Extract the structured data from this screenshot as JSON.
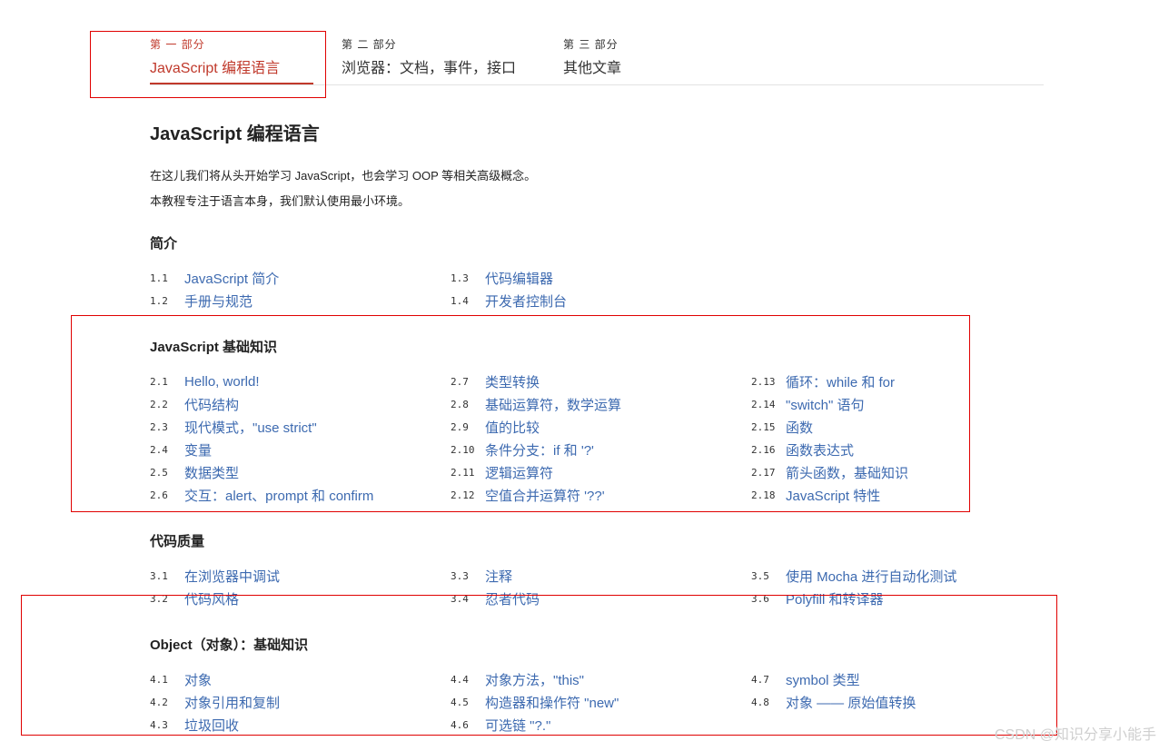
{
  "tabs": [
    {
      "kicker": "第 一 部分",
      "label": "JavaScript 编程语言",
      "active": true
    },
    {
      "kicker": "第 二 部分",
      "label": "浏览器：文档，事件，接口",
      "active": false
    },
    {
      "kicker": "第 三 部分",
      "label": "其他文章",
      "active": false
    }
  ],
  "main": {
    "title": "JavaScript 编程语言",
    "intro": [
      "在这儿我们将从头开始学习 JavaScript，也会学习 OOP 等相关高级概念。",
      "本教程专注于语言本身，我们默认使用最小环境。"
    ]
  },
  "sections": [
    {
      "title": "简介",
      "items": [
        {
          "num": "1.1",
          "text": "JavaScript 简介"
        },
        {
          "num": "1.2",
          "text": "手册与规范"
        },
        {
          "num": "1.3",
          "text": "代码编辑器"
        },
        {
          "num": "1.4",
          "text": "开发者控制台"
        }
      ]
    },
    {
      "title": "JavaScript 基础知识",
      "items": [
        {
          "num": "2.1",
          "text": "Hello, world!"
        },
        {
          "num": "2.2",
          "text": "代码结构"
        },
        {
          "num": "2.3",
          "text": "现代模式，\"use strict\""
        },
        {
          "num": "2.4",
          "text": "变量"
        },
        {
          "num": "2.5",
          "text": "数据类型"
        },
        {
          "num": "2.6",
          "text": "交互：alert、prompt 和 confirm"
        },
        {
          "num": "2.7",
          "text": "类型转换"
        },
        {
          "num": "2.8",
          "text": "基础运算符，数学运算"
        },
        {
          "num": "2.9",
          "text": "值的比较"
        },
        {
          "num": "2.10",
          "text": "条件分支：if 和 '?'"
        },
        {
          "num": "2.11",
          "text": "逻辑运算符"
        },
        {
          "num": "2.12",
          "text": "空值合并运算符 '??'"
        },
        {
          "num": "2.13",
          "text": "循环：while 和 for"
        },
        {
          "num": "2.14",
          "text": "\"switch\" 语句"
        },
        {
          "num": "2.15",
          "text": "函数"
        },
        {
          "num": "2.16",
          "text": "函数表达式"
        },
        {
          "num": "2.17",
          "text": "箭头函数，基础知识"
        },
        {
          "num": "2.18",
          "text": "JavaScript 特性"
        }
      ]
    },
    {
      "title": "代码质量",
      "items": [
        {
          "num": "3.1",
          "text": "在浏览器中调试"
        },
        {
          "num": "3.2",
          "text": "代码风格"
        },
        {
          "num": "3.3",
          "text": "注释"
        },
        {
          "num": "3.4",
          "text": "忍者代码"
        },
        {
          "num": "3.5",
          "text": "使用 Mocha 进行自动化测试"
        },
        {
          "num": "3.6",
          "text": "Polyfill 和转译器"
        }
      ]
    },
    {
      "title": "Object（对象）：基础知识",
      "items": [
        {
          "num": "4.1",
          "text": "对象"
        },
        {
          "num": "4.2",
          "text": "对象引用和复制"
        },
        {
          "num": "4.3",
          "text": "垃圾回收"
        },
        {
          "num": "4.4",
          "text": "对象方法，\"this\""
        },
        {
          "num": "4.5",
          "text": "构造器和操作符 \"new\""
        },
        {
          "num": "4.6",
          "text": "可选链 \"?.\""
        },
        {
          "num": "4.7",
          "text": "symbol 类型"
        },
        {
          "num": "4.8",
          "text": "对象 —— 原始值转换"
        }
      ]
    }
  ],
  "watermark": "CSDN @知识分享小能手",
  "colors": {
    "accent": "#c0392b",
    "link": "#3d6ab0",
    "annotation": "#e00000"
  }
}
